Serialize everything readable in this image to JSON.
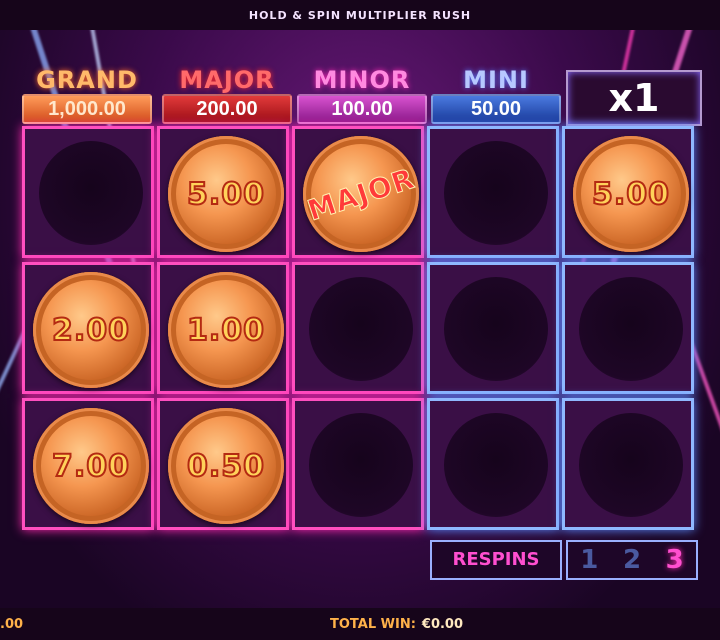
{
  "header": {
    "title": "HOLD & SPIN MULTIPLIER RUSH"
  },
  "jackpots": [
    {
      "label": "GRAND",
      "value": "1,000.00"
    },
    {
      "label": "MAJOR",
      "value": "200.00"
    },
    {
      "label": "MINOR",
      "value": "100.00"
    },
    {
      "label": "MINI",
      "value": "50.00"
    }
  ],
  "multiplier": {
    "value": "x1"
  },
  "grid": {
    "rows": 3,
    "cols": 5,
    "coins": [
      {
        "row": 0,
        "col": 1,
        "text": "5.00"
      },
      {
        "row": 0,
        "col": 2,
        "text": "MAJOR"
      },
      {
        "row": 0,
        "col": 4,
        "text": "5.00"
      },
      {
        "row": 1,
        "col": 0,
        "text": "2.00"
      },
      {
        "row": 1,
        "col": 1,
        "text": "1.00"
      },
      {
        "row": 2,
        "col": 0,
        "text": "7.00"
      },
      {
        "row": 2,
        "col": 1,
        "text": "0.50"
      }
    ]
  },
  "respins": {
    "label": "RESPINS",
    "counts": [
      "1",
      "2",
      "3"
    ],
    "active": "3"
  },
  "footer": {
    "balance_fragment": ".00",
    "total_win_label": "TOTAL WIN:",
    "total_win_value": "€0.00"
  },
  "colors": {
    "neon_pink": "#ff4fbf",
    "neon_blue": "#8fb8ff",
    "coin_orange": "#f59650",
    "win_text": "#ffb24a"
  }
}
